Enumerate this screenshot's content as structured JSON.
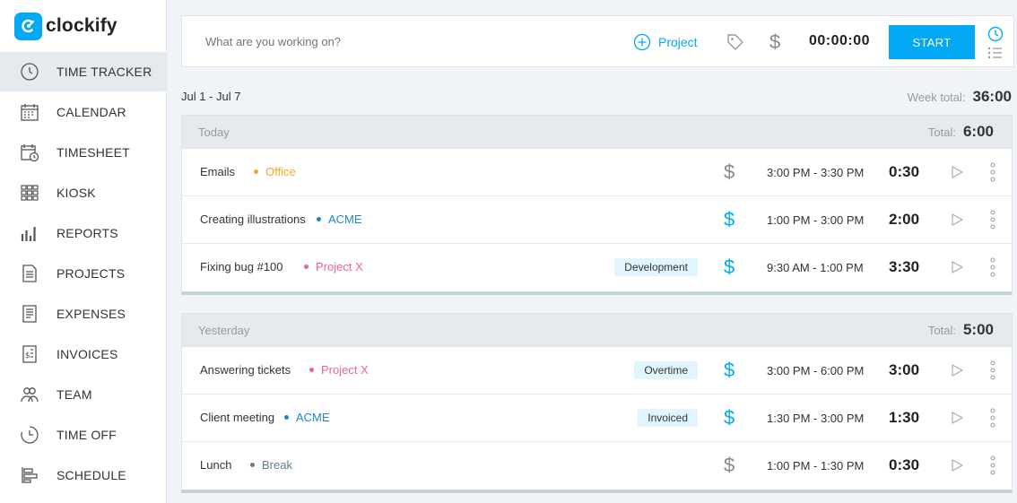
{
  "app": {
    "name": "clockify"
  },
  "colors": {
    "accent": "#03a9f4",
    "orange": "#f5a623",
    "pink": "#f06292",
    "slate": "#607d8b",
    "billable": "#03a9f4",
    "nonbillable": "#888888"
  },
  "sidebar": {
    "items": [
      {
        "label": "TIME TRACKER",
        "icon": "clock-icon",
        "active": true
      },
      {
        "label": "CALENDAR",
        "icon": "calendar-icon"
      },
      {
        "label": "TIMESHEET",
        "icon": "timesheet-icon"
      },
      {
        "label": "KIOSK",
        "icon": "kiosk-icon"
      },
      {
        "label": "REPORTS",
        "icon": "reports-icon"
      },
      {
        "label": "PROJECTS",
        "icon": "projects-icon"
      },
      {
        "label": "EXPENSES",
        "icon": "expenses-icon"
      },
      {
        "label": "INVOICES",
        "icon": "invoices-icon"
      },
      {
        "label": "TEAM",
        "icon": "team-icon"
      },
      {
        "label": "TIME OFF",
        "icon": "time-off-icon"
      },
      {
        "label": "SCHEDULE",
        "icon": "schedule-icon"
      }
    ]
  },
  "timer": {
    "placeholder": "What are you working on?",
    "project_label": "Project",
    "dollar": "$",
    "time": "00:00:00",
    "start_label": "START"
  },
  "week": {
    "range": "Jul 1 - Jul 7",
    "total_label": "Week total:",
    "total": "36:00"
  },
  "days": [
    {
      "label": "Today",
      "total_label": "Total:",
      "total": "6:00",
      "entries": [
        {
          "desc": "Emails",
          "project": "Office",
          "project_color": "#f5a623",
          "tag": "",
          "billable": false,
          "range": "3:00 PM - 3:30 PM",
          "duration": "0:30"
        },
        {
          "desc": "Creating illustrations",
          "project": "ACME",
          "project_color": "#1e88c7",
          "tag": "",
          "billable": true,
          "range": "1:00 PM - 3:00 PM",
          "duration": "2:00"
        },
        {
          "desc": "Fixing bug #100",
          "project": "Project X",
          "project_color": "#f06292",
          "tag": "Development",
          "billable": true,
          "range": "9:30 AM - 1:00 PM",
          "duration": "3:30"
        }
      ]
    },
    {
      "label": "Yesterday",
      "total_label": "Total:",
      "total": "5:00",
      "entries": [
        {
          "desc": "Answering tickets",
          "project": "Project X",
          "project_color": "#f06292",
          "tag": "Overtime",
          "billable": true,
          "range": "3:00 PM - 6:00 PM",
          "duration": "3:00"
        },
        {
          "desc": "Client meeting",
          "project": "ACME",
          "project_color": "#1e88c7",
          "tag": "Invoiced",
          "billable": true,
          "range": "1:30 PM - 3:00 PM",
          "duration": "1:30"
        },
        {
          "desc": "Lunch",
          "project": "Break",
          "project_color": "#607d8b",
          "tag": "",
          "billable": false,
          "range": "1:00 PM - 1:30 PM",
          "duration": "0:30"
        }
      ]
    }
  ]
}
